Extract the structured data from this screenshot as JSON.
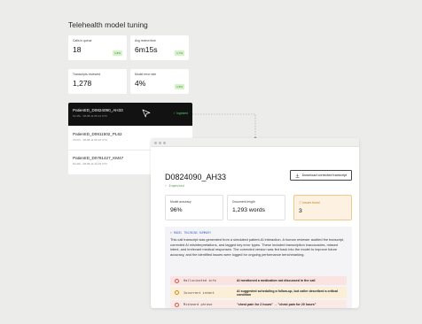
{
  "page": {
    "title": "Telehealth model tuning"
  },
  "metrics": [
    {
      "label": "Calls in queue",
      "value": "18",
      "delta": "1.8%"
    },
    {
      "label": "Avg review time",
      "value": "6m15s",
      "delta": "1.7%"
    },
    {
      "label": "Transcripts reviewed",
      "value": "1,278",
      "delta": ""
    },
    {
      "label": "Model error rate",
      "value": "4%",
      "delta": "1.8%"
    }
  ],
  "records": [
    {
      "id": "PatientID_D0824090_AH33",
      "meta": "6m45s · 08-08-11-56-12 UTC",
      "status": "Ingested"
    },
    {
      "id": "PatientID_D0811502_PL62",
      "meta": "7m07s · 08-08-11-56-16 UTC",
      "status": ""
    },
    {
      "id": "PatientID_D0791427_KM47",
      "meta": "6m40s · 08-08-11-23-33 UTC",
      "status": ""
    }
  ],
  "detail": {
    "title": "D0824090_AH33",
    "status": "✓ Ingested",
    "download_label": "Download corrected transcript",
    "stats": [
      {
        "label": "Model accuracy",
        "value": "96%"
      },
      {
        "label": "Document length",
        "value": "1,293 words"
      },
      {
        "label": "Issues found",
        "value": "3"
      }
    ],
    "summary_label": "> MODEL TRAINING SUMMARY",
    "summary_text": "This call transcript was generated from a simulated patient-AI interaction. A human reviewer audited the transcript, corrected AI misinterpretations, and tagged key error types. These included transcription inaccuracies, missed intent, and irrelevant medical responses. The corrected version was fed back into the model to improve future accuracy, and the identified issues were logged for ongoing performance benchmarking.",
    "issues": [
      {
        "type": "Hallucinated info",
        "desc": "AI mentioned a medication not discussed in the call"
      },
      {
        "type": "Incorrect intent",
        "desc": "AI suggested scheduling a follow-up, but caller described a critical condition"
      },
      {
        "type": "Misheard phrase",
        "desc": "\"chest pain for 2 hours\" → \"chest pain for 20 hours\""
      }
    ]
  },
  "colors": {
    "background": "#ececeb",
    "active_record": "#121212",
    "success": "#59c96a",
    "warning": "#c27b14",
    "error": "#d0584c"
  }
}
